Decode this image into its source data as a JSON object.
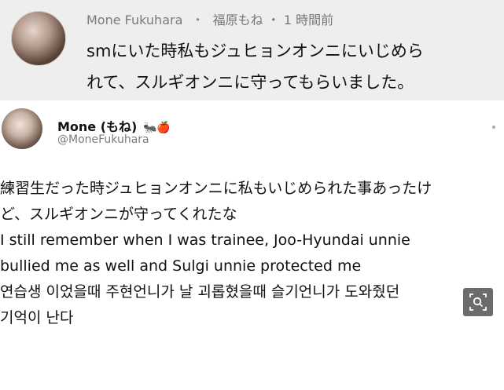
{
  "top_post": {
    "name": "Mone Fukuhara",
    "separator": "・",
    "alt_name": "福原もね",
    "dot": "・",
    "time": "1 時間前",
    "line1": "smにいた時私もジュヒョンオンニにいじめら",
    "line2": "れて、スルギオンニに守ってもらいました。"
  },
  "tweet": {
    "name": "Mone (もね)",
    "emojis": "🐜🍎",
    "handle": "@MoneFukuhara",
    "lines": [
      "練習生だった時ジュヒョンオンニに私もいじめられた事あったけ",
      "ど、スルギオンニが守ってくれたな",
      "I still remember when I was trainee, Joo-Hyundai unnie",
      "bullied me as well and Sulgi unnie protected me",
      "연습생 이었을때 주현언니가 날 괴롭혔을때 슬기언니가 도와줬던",
      "기억이 난다"
    ]
  },
  "overlay": {
    "icon": "image-search-icon"
  }
}
